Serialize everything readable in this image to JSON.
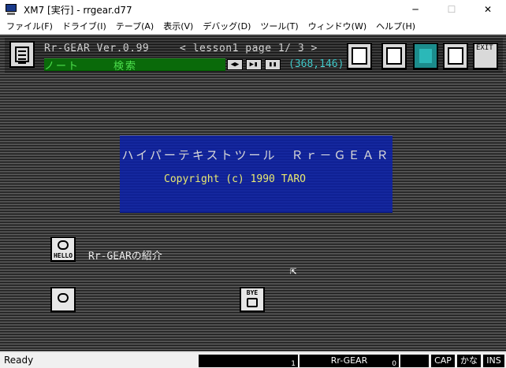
{
  "window": {
    "title": "XM7 [実行] - rrgear.d77",
    "minimize": "─",
    "maximize": "☐",
    "close": "✕"
  },
  "menubar": {
    "items": [
      "ファイル(F)",
      "ドライブ(I)",
      "テープ(A)",
      "表示(V)",
      "デバッグ(D)",
      "ツール(T)",
      "ウィンドウ(W)",
      "ヘルプ(H)"
    ]
  },
  "emulator": {
    "version": "Rr-GEAR Ver.0.99",
    "lesson": "< lesson1  page  1/ 3 >",
    "mode": "ノート",
    "search": "検索",
    "nav_prev": "◀▶",
    "nav_mid": "▶▮",
    "nav_next": "▮▮",
    "coord": "(368,146)",
    "exit_label": "EXIT",
    "banner_title": "ハイパーテキストツール　Ｒｒ－ＧＥＡＲ",
    "banner_copyright": "Copyright (c) 1990 TARO",
    "hello_caption": "HELLO",
    "intro": "Rr-GEARの紹介",
    "bye_caption": "BYE"
  },
  "statusbar": {
    "status": "Ready",
    "field1_num": "1",
    "field2": "Rr-GEAR",
    "field2_num": "0",
    "cap": "CAP",
    "kana": "かな",
    "ins": "INS"
  },
  "colors": {
    "banner_blue": "#1a2ea8",
    "mode_green": "#4de04d",
    "coord_cyan": "#3fc7c7",
    "copyright_yellow": "#e8e870"
  }
}
